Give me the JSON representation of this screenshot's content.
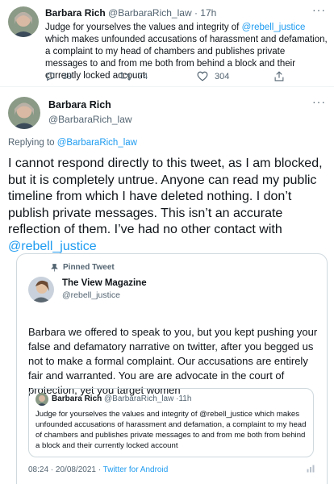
{
  "first_tweet": {
    "name": "Barbara Rich",
    "handle": "@BarbaraRich_law",
    "time": "17h",
    "body_parts": [
      "Judge for yourselves the values and integrity of ",
      "@rebell_justice",
      " which makes unfounded accusations of harassment and defamation, a complaint to my head of chambers and publishes private messages to and from me both from behind a block and their currently locked account"
    ],
    "replies": "39",
    "retweets": "74",
    "likes": "304"
  },
  "reply_tweet": {
    "name": "Barbara Rich",
    "handle": "@BarbaraRich_law",
    "replying_prefix": "Replying to ",
    "replying_to": "@BarbaraRich_law",
    "body_text": "I cannot respond directly to this tweet, as I am blocked, but it is completely untrue. Anyone can read my public timeline from which I have deleted nothing. I don’t publish private messages. This isn’t an accurate reflection of them. I’ve had no other contact with ",
    "body_mention": "@rebell_justice"
  },
  "quoted_card": {
    "pinned_label": "Pinned Tweet",
    "name": "The View Magazine",
    "handle": "@rebell_justice",
    "body": "Barbara we offered to speak to you, but you kept pushing your false and defamatory narrative on twitter, after you begged us not to make a formal complaint. Our accusations are entirely fair and warranted. You are are advocate in the court of protection, yet you target women",
    "inner": {
      "name": "Barbara Rich",
      "handle": "@BarbaraRich_law",
      "time": "11h",
      "body": "Judge for yourselves the values and integrity of @rebell_justice which makes unfounded accusations of harassment and defamation, a complaint to my head of chambers and publishes private messages to and from me both from behind a block and their currently locked account"
    },
    "timestamp": "08:24 · 20/08/2021 · ",
    "source": "Twitter for Android"
  },
  "icons": [
    "reply-icon",
    "retweet-icon",
    "like-icon",
    "share-icon",
    "more-icon",
    "pin-icon"
  ],
  "colors": {
    "link": "#1d9bf0",
    "muted": "#536471",
    "border": "#cfd9de"
  }
}
